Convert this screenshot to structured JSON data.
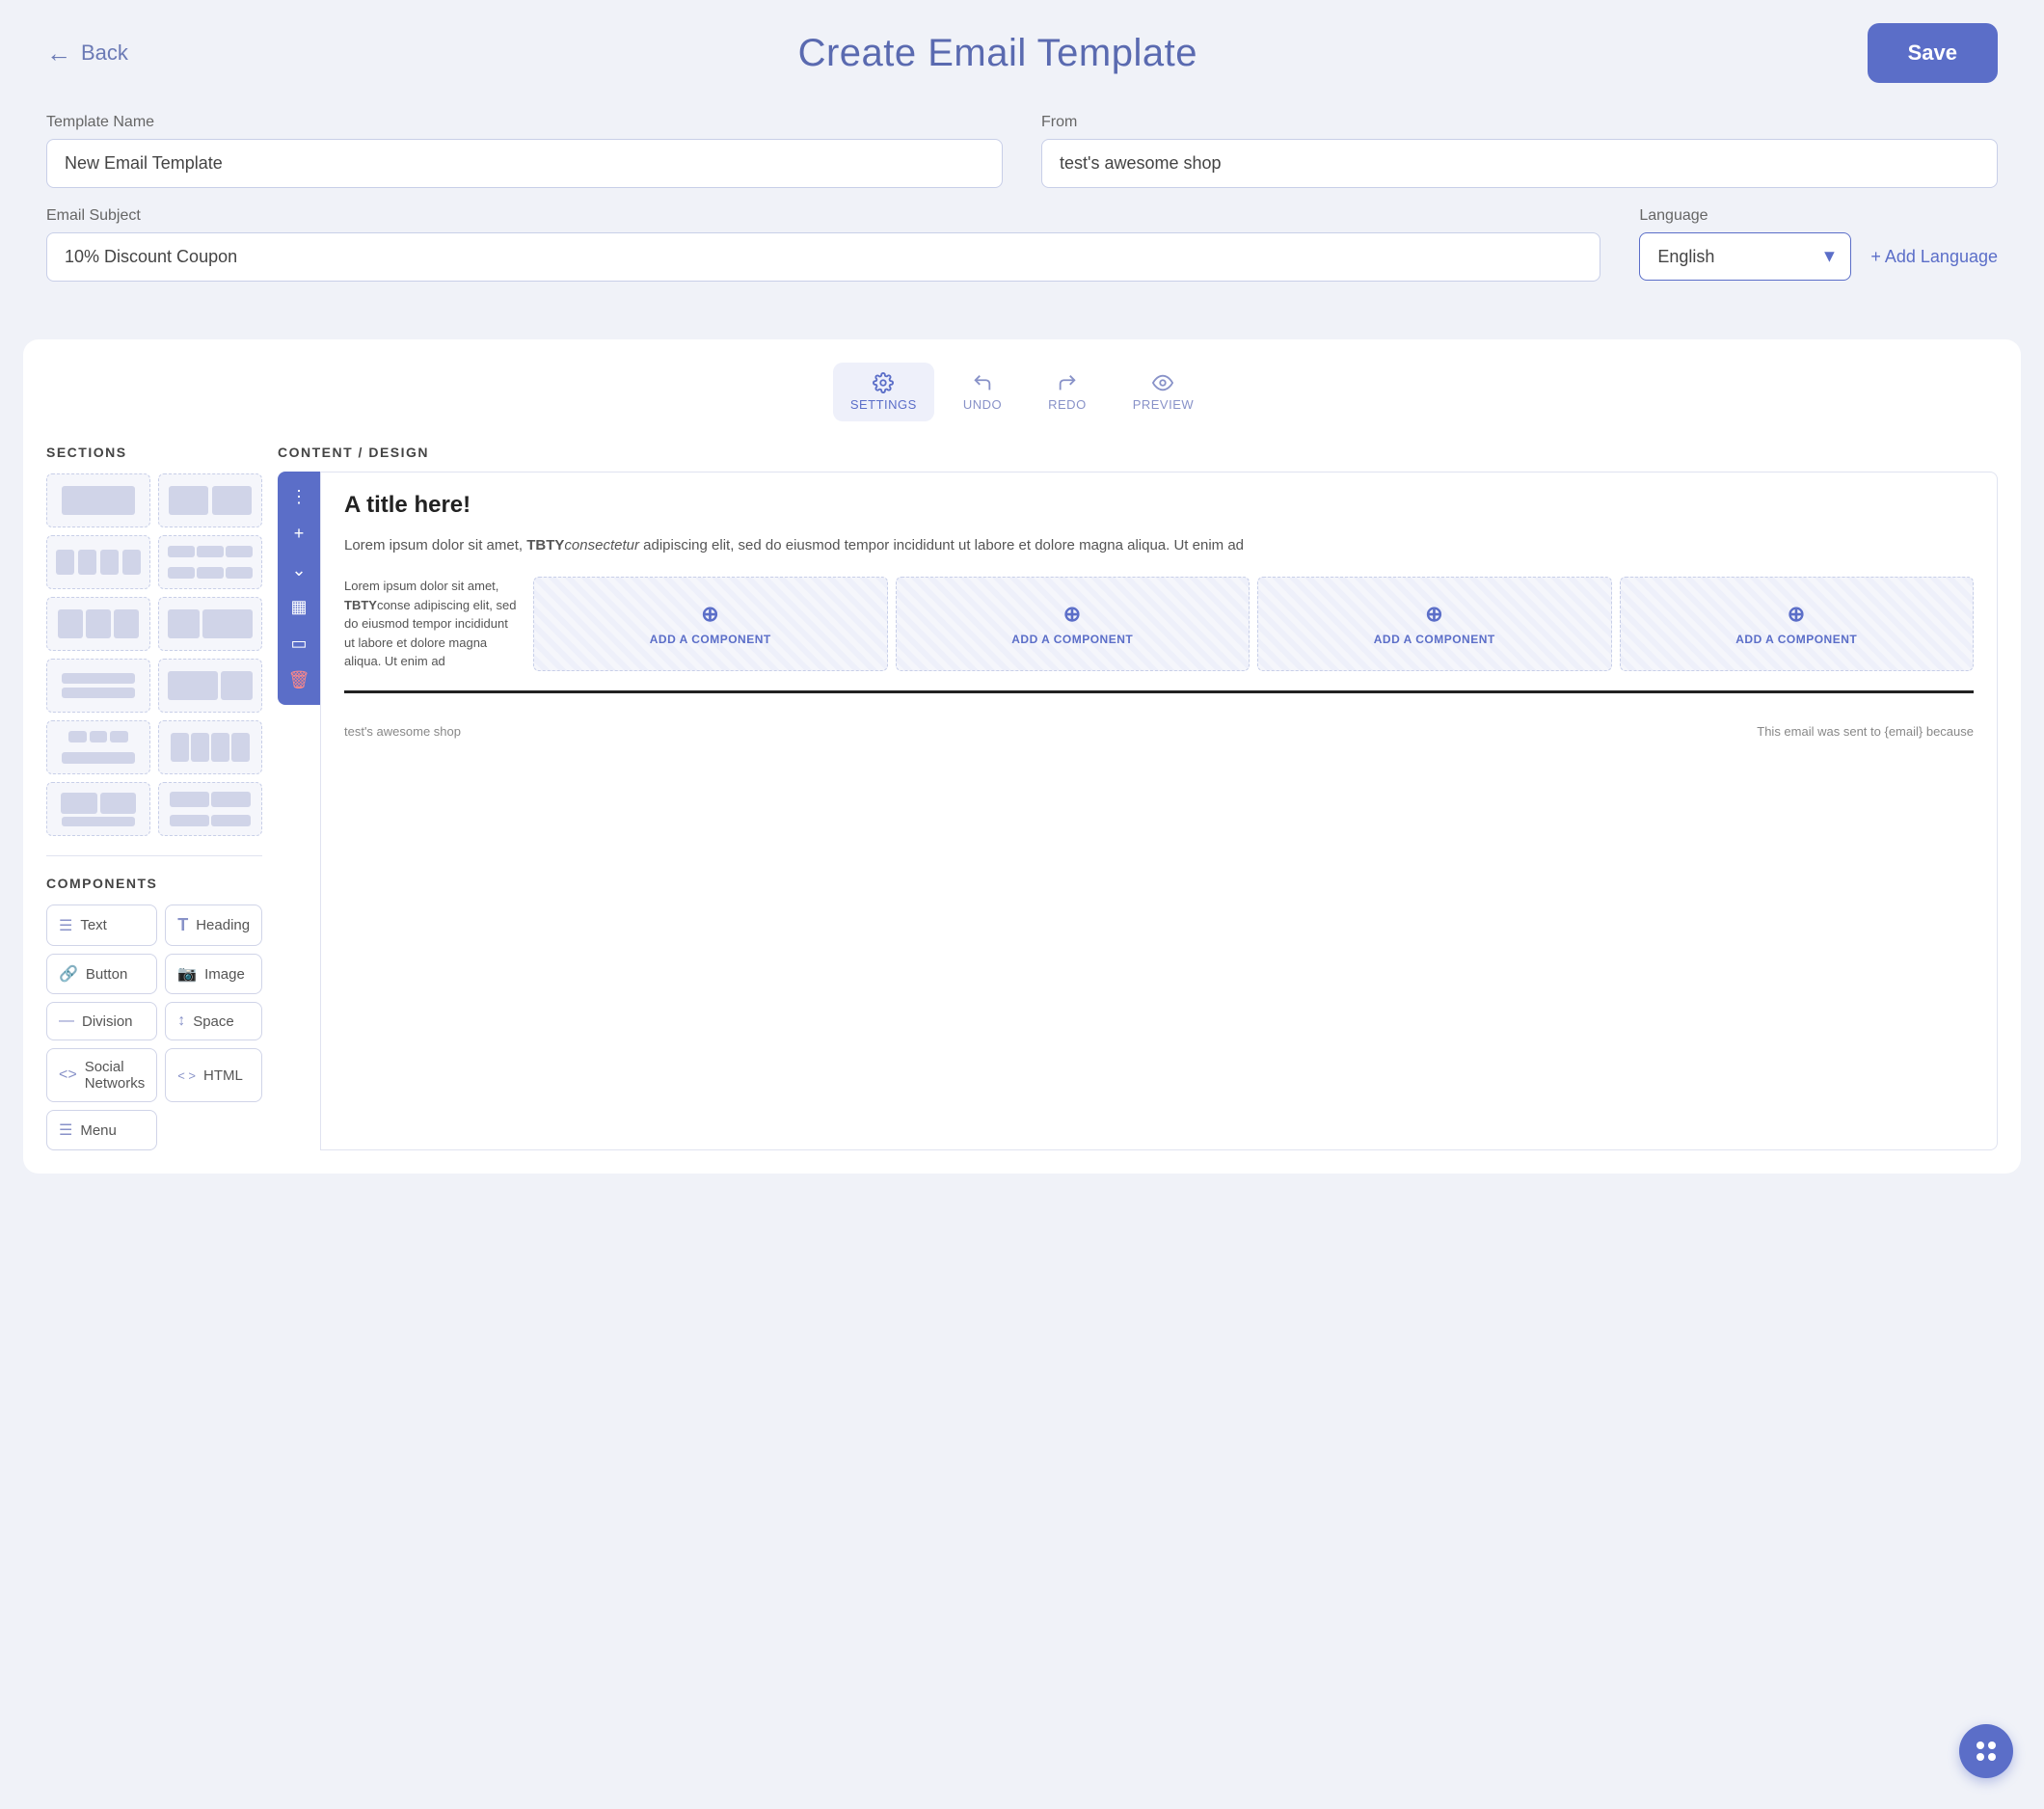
{
  "header": {
    "back_label": "Back",
    "title": "Create Email Template",
    "save_label": "Save"
  },
  "form": {
    "template_name_label": "Template Name",
    "template_name_value": "New Email Template",
    "from_label": "From",
    "from_value": "test's awesome shop",
    "email_subject_label": "Email Subject",
    "email_subject_value": "10% Discount Coupon",
    "language_label": "Language",
    "language_value": "English",
    "add_language_label": "+ Add Language"
  },
  "toolbar": {
    "settings_label": "SETTINGS",
    "undo_label": "UNDO",
    "redo_label": "REDO",
    "preview_label": "PREVIEW"
  },
  "sidebar": {
    "sections_title": "SECTIONS",
    "components_title": "COMPONENTS",
    "components": [
      {
        "label": "Text",
        "icon": "text-icon"
      },
      {
        "label": "Heading",
        "icon": "heading-icon"
      },
      {
        "label": "Button",
        "icon": "button-icon"
      },
      {
        "label": "Image",
        "icon": "image-icon"
      },
      {
        "label": "Division",
        "icon": "division-icon"
      },
      {
        "label": "Space",
        "icon": "space-icon"
      },
      {
        "label": "Social Networks",
        "icon": "social-icon"
      },
      {
        "label": "HTML",
        "icon": "html-icon"
      },
      {
        "label": "Menu",
        "icon": "menu-icon"
      }
    ]
  },
  "content": {
    "email_title": "A title here!",
    "email_body": "Lorem ipsum dolor sit amet, TBTY consectetur adipiscing elit, sed do eiusmod tempor incididunt ut labore et dolore magna aliqua. Ut enim ad",
    "email_body_bold": "TBTY",
    "email_body_italic": "consectetur",
    "email_col_text": "Lorem ipsum dolor sit amet, TBTYconse adipiscing elit, sed do eiusmod tempor incididunt ut labore et dolore magna aliqua. Ut enim ad",
    "add_component_label": "ADD A COMPONENT",
    "footer_text": "test's awesome shop",
    "footer_email_text": "This email was sent to {email} because"
  }
}
